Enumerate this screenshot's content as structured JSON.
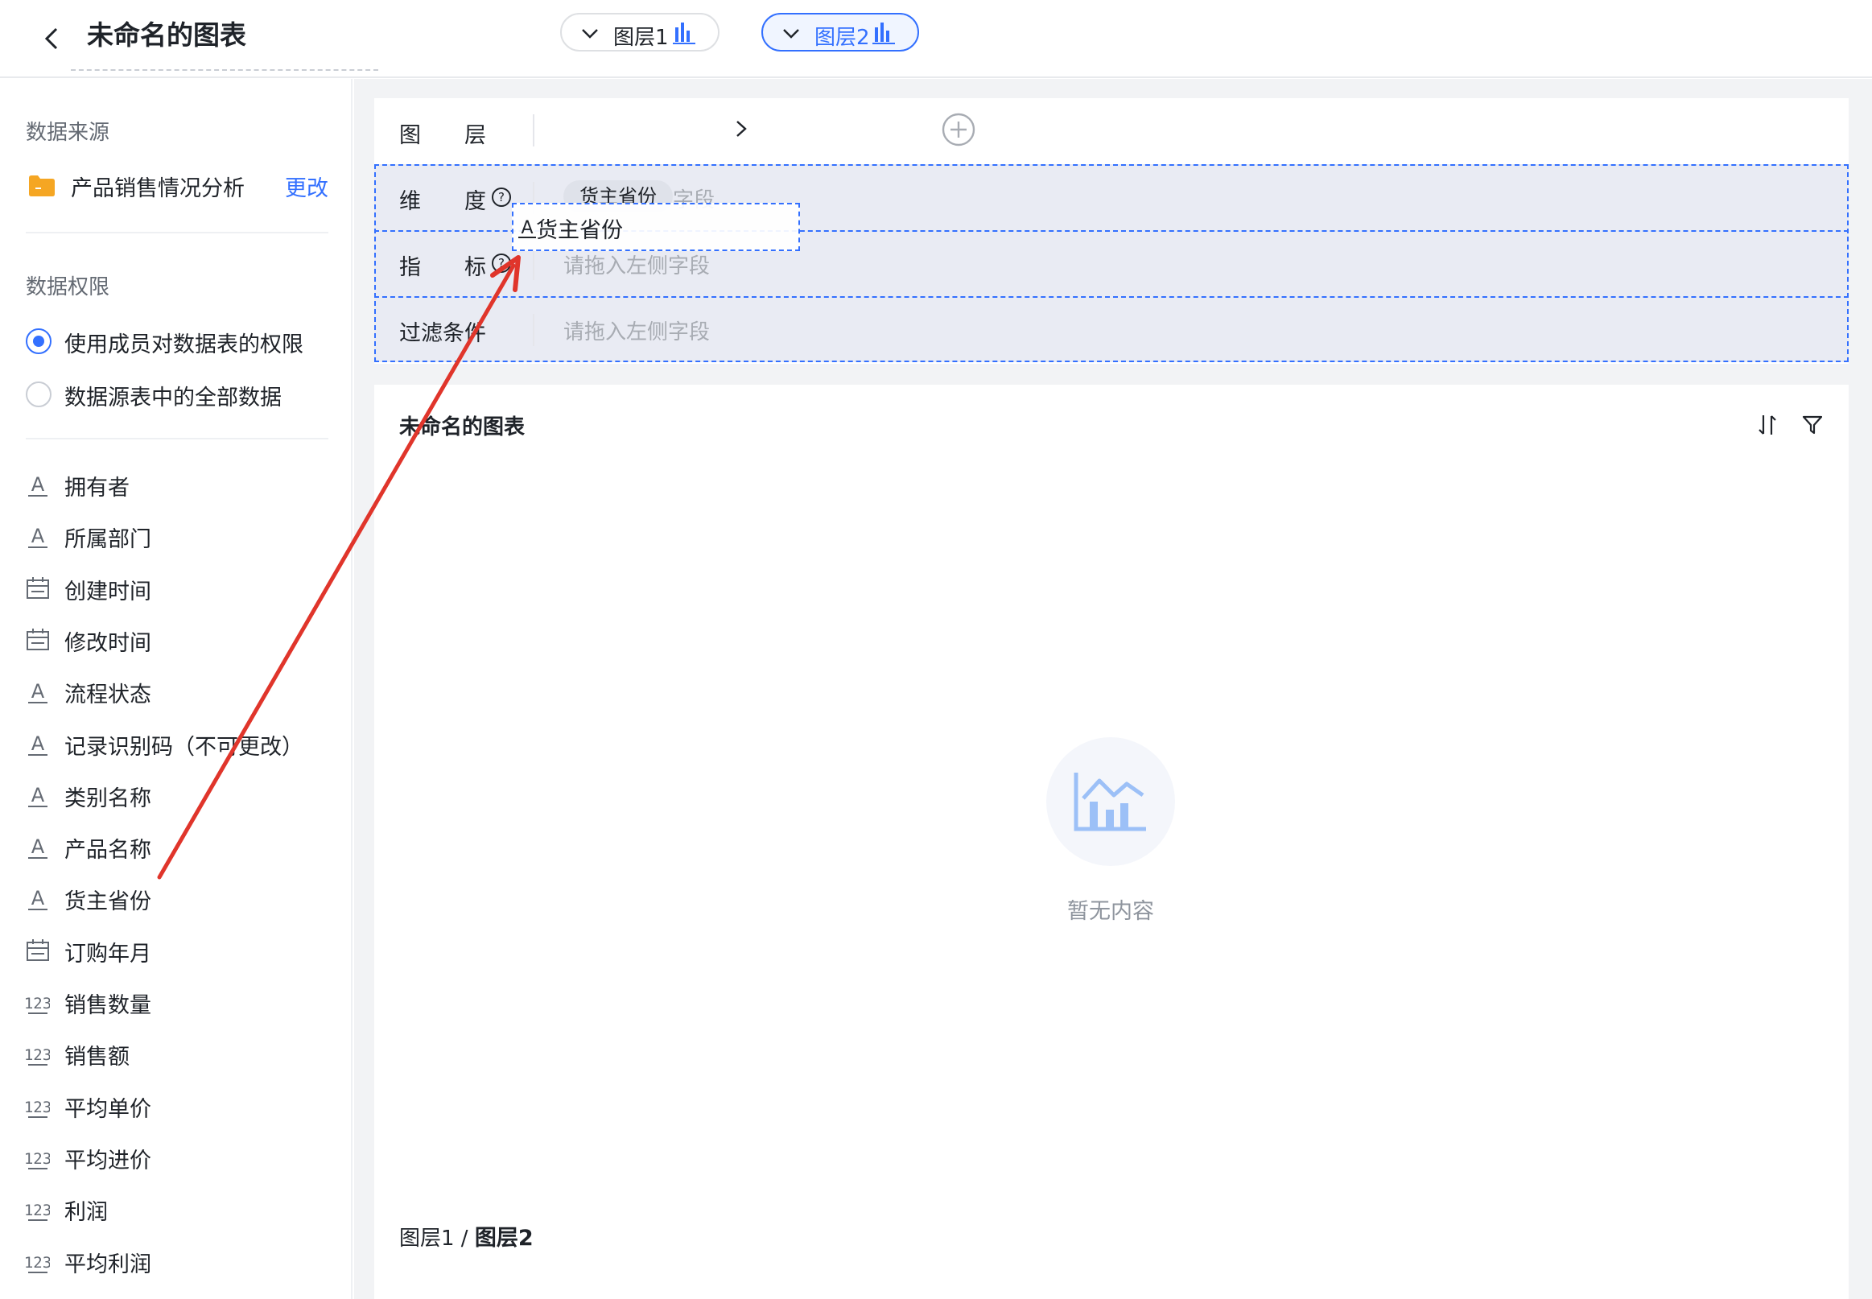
{
  "header": {
    "title": "未命名的图表"
  },
  "sidebar": {
    "data_source_title": "数据来源",
    "data_source_name": "产品销售情况分析",
    "change_label": "更改",
    "permission_title": "数据权限",
    "permission_options": [
      {
        "label": "使用成员对数据表的权限",
        "selected": true
      },
      {
        "label": "数据源表中的全部数据",
        "selected": false
      }
    ],
    "fields": [
      {
        "label": "拥有者",
        "icon": "text-field-icon"
      },
      {
        "label": "所属部门",
        "icon": "text-field-icon"
      },
      {
        "label": "创建时间",
        "icon": "date-field-icon"
      },
      {
        "label": "修改时间",
        "icon": "date-field-icon"
      },
      {
        "label": "流程状态",
        "icon": "text-field-icon"
      },
      {
        "label": "记录识别码（不可更改）",
        "icon": "text-field-icon"
      },
      {
        "label": "类别名称",
        "icon": "text-field-icon"
      },
      {
        "label": "产品名称",
        "icon": "text-field-icon"
      },
      {
        "label": "货主省份",
        "icon": "text-field-icon"
      },
      {
        "label": "订购年月",
        "icon": "date-field-icon"
      },
      {
        "label": "销售数量",
        "icon": "number-field-icon"
      },
      {
        "label": "销售额",
        "icon": "number-field-icon"
      },
      {
        "label": "平均单价",
        "icon": "number-field-icon"
      },
      {
        "label": "平均进价",
        "icon": "number-field-icon"
      },
      {
        "label": "利润",
        "icon": "number-field-icon"
      },
      {
        "label": "平均利润",
        "icon": "number-field-icon"
      }
    ]
  },
  "config": {
    "layer_label": "图　　层",
    "layers": [
      {
        "label": "图层1",
        "active": false
      },
      {
        "label": "图层2",
        "active": true
      }
    ],
    "dimension_label": "维　　度",
    "dimension_chip": "货主省份",
    "dimension_placeholder_tail": "字段",
    "metric_label": "指　　标",
    "metric_placeholder": "请拖入左侧字段",
    "filter_label": "过滤条件",
    "filter_placeholder": "请拖入左侧字段",
    "drag_ghost_label": "货主省份"
  },
  "chart": {
    "title": "未命名的图表",
    "empty_text": "暂无内容",
    "breadcrumb_layer1": "图层1",
    "breadcrumb_sep": " / ",
    "breadcrumb_layer2": "图层2"
  },
  "colors": {
    "accent": "#3370ff",
    "annotation_arrow": "#e0352b",
    "folder": "#f5a623"
  }
}
